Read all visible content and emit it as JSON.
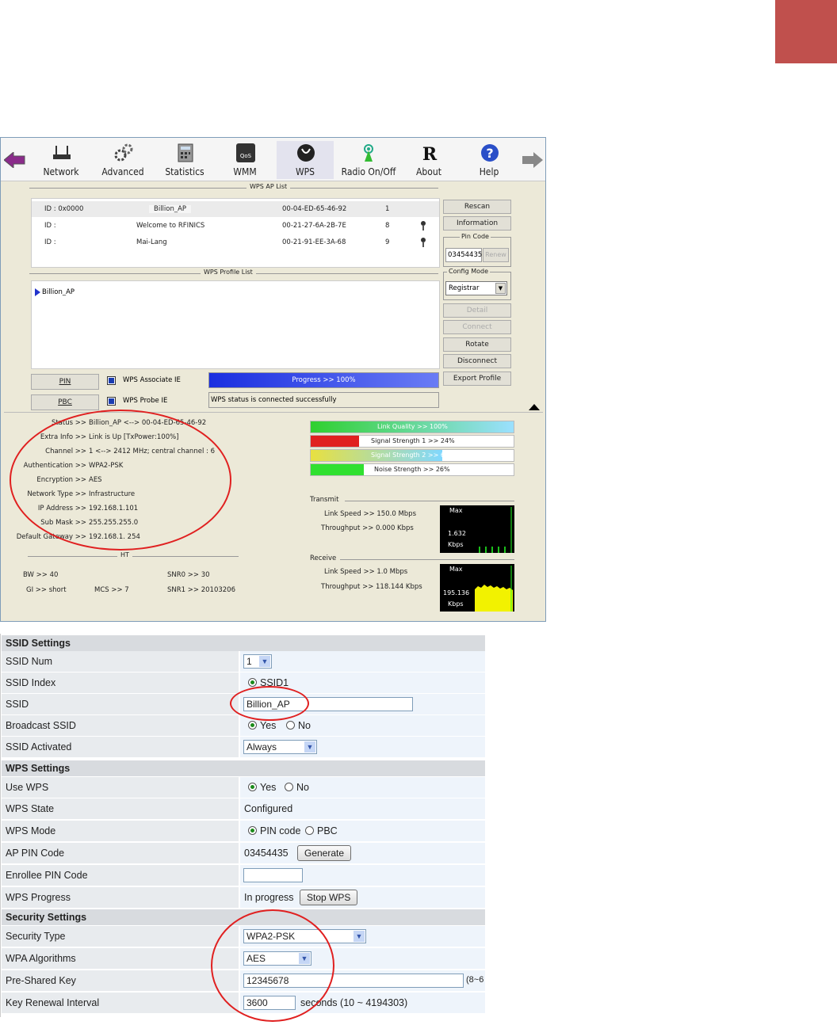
{
  "toolbar": {
    "items": [
      {
        "label": "Network",
        "icon": "router-icon"
      },
      {
        "label": "Advanced",
        "icon": "gears-icon"
      },
      {
        "label": "Statistics",
        "icon": "calculator-icon"
      },
      {
        "label": "WMM",
        "icon": "qos-icon"
      },
      {
        "label": "WPS",
        "icon": "wps-icon"
      },
      {
        "label": "Radio On/Off",
        "icon": "radio-icon"
      },
      {
        "label": "About",
        "icon": "about-icon"
      },
      {
        "label": "Help",
        "icon": "help-icon"
      }
    ]
  },
  "wps": {
    "ap_list_title": "WPS AP List",
    "ap_rows": [
      {
        "id": "ID : 0x0000",
        "ssid": "Billion_AP",
        "mac": "00-04-ED-65-46-92",
        "ch": "1"
      },
      {
        "id": "ID :",
        "ssid": "Welcome to RFINICS",
        "mac": "00-21-27-6A-2B-7E",
        "ch": "8"
      },
      {
        "id": "ID :",
        "ssid": "Mai-Lang",
        "mac": "00-21-91-EE-3A-68",
        "ch": "9"
      }
    ],
    "profile_list_title": "WPS Profile List",
    "profile_item": "Billion_AP",
    "buttons": {
      "rescan": "Rescan",
      "information": "Information",
      "detail": "Detail",
      "connect": "Connect",
      "rotate": "Rotate",
      "disconnect": "Disconnect",
      "export_profile": "Export Profile",
      "pin": "PIN",
      "pbc": "PBC",
      "renew": "Renew"
    },
    "pin_code_legend": "Pin Code",
    "pin_code": "03454435",
    "config_mode_legend": "Config Mode",
    "config_mode": "Registrar",
    "associate_ie": "WPS Associate IE",
    "probe_ie": "WPS Probe IE",
    "progress_text": "Progress >> 100%",
    "progress": 1.0,
    "status_text": "WPS status is connected successfully"
  },
  "status": {
    "rows": [
      {
        "label": "Status >>",
        "value": "Billion_AP  <--> 00-04-ED-65-46-92"
      },
      {
        "label": "Extra Info >>",
        "value": "Link is Up [TxPower:100%]"
      },
      {
        "label": "Channel >>",
        "value": "1 <--> 2412 MHz; central channel : 6"
      },
      {
        "label": "Authentication >>",
        "value": "WPA2-PSK"
      },
      {
        "label": "Encryption >>",
        "value": "AES"
      },
      {
        "label": "Network Type >>",
        "value": "Infrastructure"
      },
      {
        "label": "IP Address >>",
        "value": "192.168.1.101"
      },
      {
        "label": "Sub Mask >>",
        "value": "255.255.255.0"
      },
      {
        "label": "Default Gateway >>",
        "value": "192.168.1. 254"
      }
    ],
    "ht_title": "HT",
    "bw": "BW >> 40",
    "gi": "GI >> short",
    "mcs": "MCS >> 7",
    "snr0": "SNR0 >> 30",
    "snr1": "SNR1 >> 20103206",
    "link_quality": {
      "text": "Link Quality >> 100%",
      "value": 1.0
    },
    "signal1": {
      "text": "Signal Strength 1 >> 24%",
      "value": 0.24
    },
    "signal2": {
      "text": "Signal Strength 2 >> 65%",
      "value": 0.65
    },
    "noise": {
      "text": "Noise Strength >> 26%",
      "value": 0.26
    },
    "transmit_title": "Transmit",
    "tx_link_speed": "Link Speed >> 150.0 Mbps",
    "tx_throughput": "Throughput >> 0.000 Kbps",
    "tx_graph_max": "Max",
    "tx_graph_value": "1.632",
    "tx_graph_unit": "Kbps",
    "receive_title": "Receive",
    "rx_link_speed": "Link Speed >> 1.0 Mbps",
    "rx_throughput": "Throughput >> 118.144 Kbps",
    "rx_graph_max": "Max",
    "rx_graph_value": "195.136",
    "rx_graph_unit": "Kbps"
  },
  "form": {
    "ssid_settings": "SSID Settings",
    "ssid_num_label": "SSID Num",
    "ssid_num": "1",
    "ssid_index_label": "SSID Index",
    "ssid_index": "SSID1",
    "ssid_label": "SSID",
    "ssid_value": "Billion_AP",
    "broadcast_label": "Broadcast SSID",
    "yes": "Yes",
    "no": "No",
    "activated_label": "SSID Activated",
    "activated_value": "Always",
    "wps_settings": "WPS Settings",
    "use_wps_label": "Use WPS",
    "wps_state_label": "WPS State",
    "wps_state": "Configured",
    "wps_mode_label": "WPS Mode",
    "pin_code_opt": "PIN code",
    "pbc_opt": "PBC",
    "ap_pin_label": "AP PIN Code",
    "ap_pin": "03454435",
    "generate": "Generate",
    "enrollee_label": "Enrollee PIN Code",
    "progress_label": "WPS Progress",
    "progress_value": "In progress",
    "stop_wps": "Stop WPS",
    "security_settings": "Security Settings",
    "security_type_label": "Security Type",
    "security_type": "WPA2-PSK",
    "wpa_alg_label": "WPA Algorithms",
    "wpa_alg": "AES",
    "psk_label": "Pre-Shared Key",
    "psk": "12345678",
    "psk_hint": "(8~6",
    "renewal_label": "Key Renewal Interval",
    "renewal": "3600",
    "renewal_unit": "seconds   (10 ~ 4194303)"
  },
  "colors": {
    "accent_block": "#c0504d",
    "annotation": "#e02020"
  }
}
